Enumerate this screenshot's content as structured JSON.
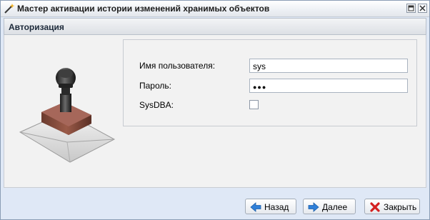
{
  "window": {
    "title": "Мастер активации истории изменений хранимых объектов",
    "icon": "wand-icon",
    "controls": [
      "restore-icon",
      "close-icon"
    ]
  },
  "header": {
    "title": "Авторизация"
  },
  "form": {
    "username": {
      "label": "Имя пользователя:",
      "value": "sys"
    },
    "password": {
      "label": "Пароль:",
      "masked_value": "●●●"
    },
    "sysdba": {
      "label": "SysDBA:",
      "checked": false
    }
  },
  "illustration": "stamp-envelope-icon",
  "buttons": {
    "back": {
      "label": "Назад",
      "icon": "arrow-left-icon"
    },
    "next": {
      "label": "Далее",
      "icon": "arrow-right-icon"
    },
    "close": {
      "label": "Закрыть",
      "icon": "red-x-icon"
    }
  },
  "colors": {
    "window_bg": "#dfe8f6",
    "panel_bg": "#f2f2f2",
    "arrow_blue": "#2f7fd8",
    "close_red": "#d42020"
  }
}
